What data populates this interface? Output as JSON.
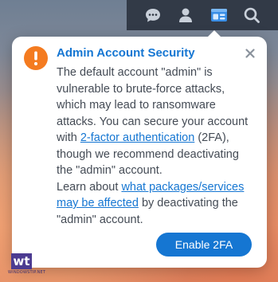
{
  "taskbar": {
    "icons": [
      "chat-icon",
      "user-icon",
      "widgets-icon",
      "search-icon"
    ],
    "active": "widgets-icon"
  },
  "popover": {
    "title": "Admin Account Security",
    "icon": "warning-icon",
    "close_glyph": "×",
    "para1_a": "The default account \"admin\" is vulnerable to brute-force attacks, which may lead to ransomware attacks. You can secure your account with ",
    "para1_link": "2-factor authentication",
    "para1_b": " (2FA), though we recommend deactivating the \"admin\" account.",
    "para2_a": "Learn about ",
    "para2_link": "what packages/services may be affected",
    "para2_b": " by deactivating the \"admin\" account.",
    "button_label": "Enable 2FA"
  },
  "watermark": {
    "logo_text": "wt",
    "sub_text": "WINDOWSTIP.NET"
  },
  "colors": {
    "accent": "#1576d2",
    "warning": "#f47b20",
    "taskbar_bg": "#2d3440"
  }
}
